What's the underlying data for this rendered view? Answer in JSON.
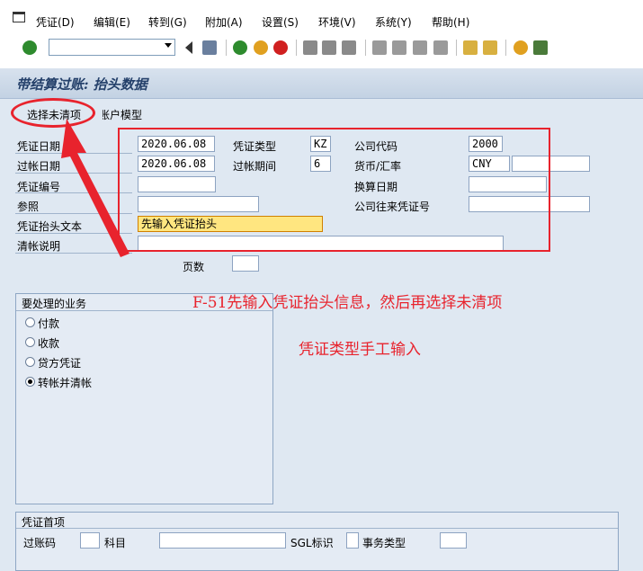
{
  "menu": {
    "items": [
      {
        "label": "凭证(D)"
      },
      {
        "label": "编辑(E)"
      },
      {
        "label": "转到(G)"
      },
      {
        "label": "附加(A)"
      },
      {
        "label": "设置(S)"
      },
      {
        "label": "环境(V)"
      },
      {
        "label": "系统(Y)"
      },
      {
        "label": "帮助(H)"
      }
    ]
  },
  "toolbar": {
    "command_value": ""
  },
  "title": "带结算过账: 抬头数据",
  "app_toolbar": {
    "select_open_items": "选择未清项",
    "account_model": "账户模型"
  },
  "header": {
    "doc_date_label": "凭证日期",
    "doc_date": "2020.06.08",
    "doc_type_label": "凭证类型",
    "doc_type": "KZ",
    "company_code_label": "公司代码",
    "company_code": "2000",
    "posting_date_label": "过帐日期",
    "posting_date": "2020.06.08",
    "period_label": "过帐期间",
    "period": "6",
    "currency_label": "货币/汇率",
    "currency": "CNY",
    "exchange_rate": "",
    "doc_number_label": "凭证编号",
    "doc_number": "",
    "translation_date_label": "换算日期",
    "translation_date": "",
    "reference_label": "参照",
    "reference": "",
    "intercompany_label": "公司往来凭证号",
    "intercompany": "",
    "header_text_label": "凭证抬头文本",
    "header_text": "先输入凭证抬头",
    "clearing_text_label": "清帐说明",
    "clearing_text": "",
    "page_label": "页数",
    "page": ""
  },
  "transactions": {
    "title": "要处理的业务",
    "options": [
      {
        "label": "付款",
        "selected": false
      },
      {
        "label": "收款",
        "selected": false
      },
      {
        "label": "贷方凭证",
        "selected": false
      },
      {
        "label": "转帐并清帐",
        "selected": true
      }
    ]
  },
  "first_line": {
    "title": "凭证首项",
    "posting_key_label": "过账码",
    "account_label": "科目",
    "sgl_label": "SGL标识",
    "trans_type_label": "事务类型"
  },
  "annotations": {
    "note1": "F-51先输入凭证抬头信息，然后再选择未清项",
    "note2": "凭证类型手工输入"
  },
  "colors": {
    "accent_red": "#e8232d",
    "title_blue": "#24406a",
    "panel_bg": "#dfe8f2"
  }
}
